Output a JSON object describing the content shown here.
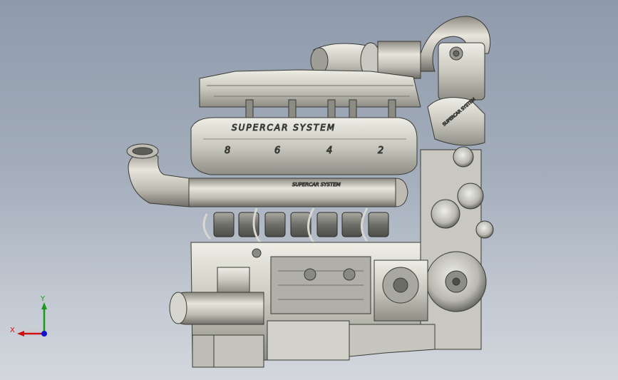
{
  "viewport": {
    "background_top": "#8f9aab",
    "background_bottom": "#d3d7dd",
    "model": {
      "description_icon": "v8-supercharged-engine-model",
      "valve_cover_text": "SUPERCAR SYSTEM",
      "valve_cover_numbers": [
        "8",
        "6",
        "4",
        "2"
      ],
      "intake_tube_text": "SUPERCAR SYSTEM",
      "pump_housing_text": "SUPERCAR SYSTEM"
    },
    "triad": {
      "x_label": "X",
      "y_label": "Y",
      "x_color": "#d01010",
      "y_color": "#1a9a1a",
      "z_color": "#1010c8"
    }
  }
}
